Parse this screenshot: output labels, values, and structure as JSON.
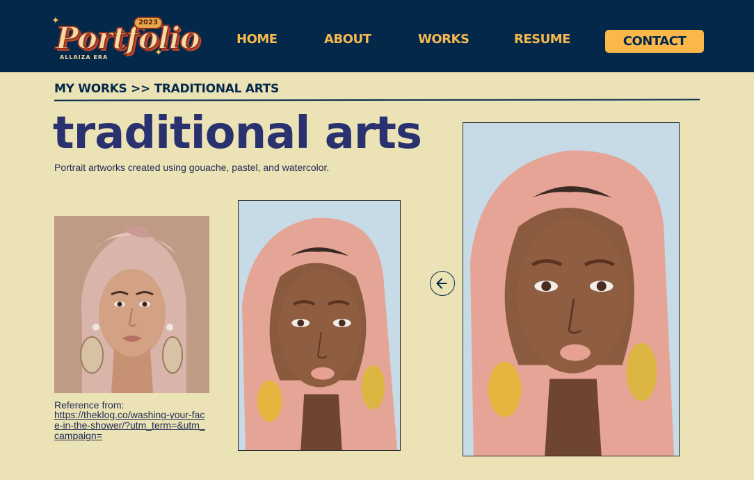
{
  "header": {
    "logo": {
      "word": "Portfolio",
      "year": "2023",
      "subtitle": "ALLAIZA ERA"
    },
    "nav": {
      "home": "HOME",
      "about": "ABOUT",
      "works": "WORKS",
      "resume": "RESUME",
      "contact": "CONTACT"
    },
    "colors": {
      "background": "#03284a",
      "accent": "#fbb84a"
    }
  },
  "breadcrumb": "MY WORKS >> TRADITIONAL ARTS",
  "page": {
    "title": "traditional arts",
    "subtitle": "Portrait artworks created using gouache, pastel, and watercolor."
  },
  "reference": {
    "label": "Reference from:",
    "link": "https://theklog.co/washing-your-face-in-the-shower/?utm_term=&utm_campaign="
  },
  "gallery": {
    "prev_icon": "arrow-left-icon"
  },
  "colors": {
    "page_background": "#ebe3b6",
    "title": "#29316e"
  }
}
